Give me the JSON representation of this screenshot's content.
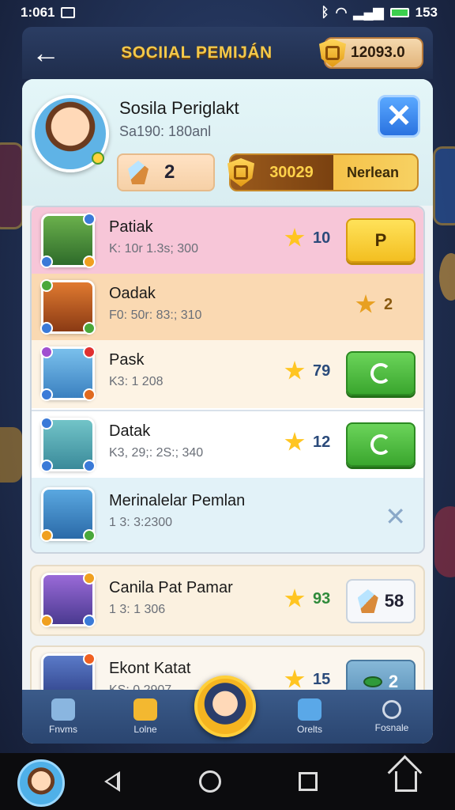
{
  "status_bar": {
    "time": "1:061",
    "battery_text": "153",
    "left_icon": "sim-icon",
    "right_icons": [
      "bluetooth-icon",
      "wifi-icon",
      "signal-icon",
      "battery-icon"
    ]
  },
  "header": {
    "title": "SOCIIAL PEMIJÁN",
    "coins": "12093.0"
  },
  "profile": {
    "name": "Sosila Periglakt",
    "subtitle": "Sa190: 180anl",
    "gems": "2",
    "gold": "30029",
    "gold_label": "Nerlean"
  },
  "list": [
    {
      "name": "Patiak",
      "sub": "K: 10r 1.3s; 300",
      "stars": "10",
      "action": "P",
      "bg": "#f7c6d8",
      "avatar_bg": "#4d9a3c"
    },
    {
      "name": "Oadak",
      "sub": "F0: 50r: 83:; 310",
      "stars": "2",
      "action": "",
      "bg": "#fad9b2",
      "avatar_bg": "#c46a2a"
    },
    {
      "name": "Pask",
      "sub": "K3: 1 208",
      "stars": "79",
      "action": "refresh",
      "bg": "#fdf3e4",
      "avatar_bg": "#55a0d8"
    },
    {
      "name": "Datak",
      "sub": "K3, 29;: 2S:; 340",
      "stars": "12",
      "action": "refresh",
      "bg": "#ffffff",
      "avatar_bg": "#4aa0a8"
    },
    {
      "name": "Merinalelar Pemlan",
      "sub": "1 3: 3:2300",
      "stars": "",
      "action": "close",
      "bg": "#e2f2f8",
      "avatar_bg": "#3a8ad0"
    }
  ],
  "cards": [
    {
      "name": "Canila Pat Pamar",
      "sub": "1 3: 1 306",
      "stars": "93",
      "action_value": "58"
    },
    {
      "name": "Ekont Katat",
      "sub": "KS: 0 2907",
      "stars": "15",
      "action_value": "2"
    }
  ],
  "nav": [
    {
      "label": "Fnvms",
      "icon": "forms-icon"
    },
    {
      "label": "Lolne",
      "icon": "scroll-icon"
    },
    {
      "label": "Orelts",
      "icon": "mail-icon"
    },
    {
      "label": "Fosnale",
      "icon": "search-icon"
    }
  ],
  "colors": {
    "accent_gold": "#f3c84a",
    "header_bg": "#2b3d63",
    "green_button": "#3aa62e",
    "blue_close": "#2a72e0"
  }
}
